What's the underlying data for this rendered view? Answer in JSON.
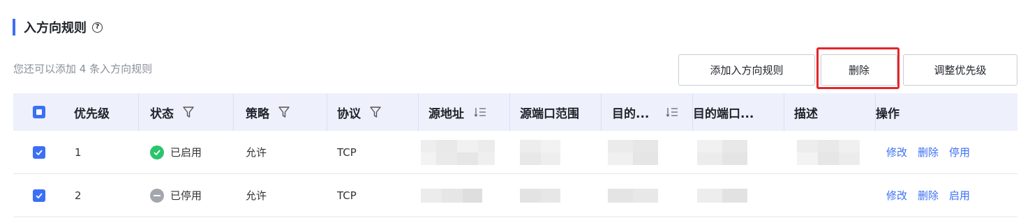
{
  "section": {
    "title": "入方向规则",
    "help": "?"
  },
  "toolbar": {
    "hint": "您还可以添加 4 条入方向规则",
    "add_label": "添加入方向规则",
    "delete_label": "删除",
    "adjust_label": "调整优先级"
  },
  "table": {
    "headers": {
      "priority": "优先级",
      "status": "状态",
      "policy": "策略",
      "protocol": "协议",
      "source": "源地址",
      "source_port": "源端口范围",
      "dest": "目的...",
      "dest_port": "目的端口...",
      "desc": "描述",
      "action": "操作"
    },
    "rows": [
      {
        "checked": true,
        "priority": "1",
        "status": "已启用",
        "status_state": "enabled",
        "policy": "允许",
        "protocol": "TCP",
        "actions": {
          "edit": "修改",
          "delete": "删除",
          "toggle": "停用"
        }
      },
      {
        "checked": true,
        "priority": "2",
        "status": "已停用",
        "status_state": "disabled",
        "policy": "允许",
        "protocol": "TCP",
        "actions": {
          "edit": "修改",
          "delete": "删除",
          "toggle": "启用"
        }
      }
    ]
  },
  "colors": {
    "accent": "#3b6ff5",
    "enabled": "#2bc46c",
    "disabled": "#a3a7ad",
    "highlight": "#e3262a",
    "header_bg": "#eef0fc"
  }
}
